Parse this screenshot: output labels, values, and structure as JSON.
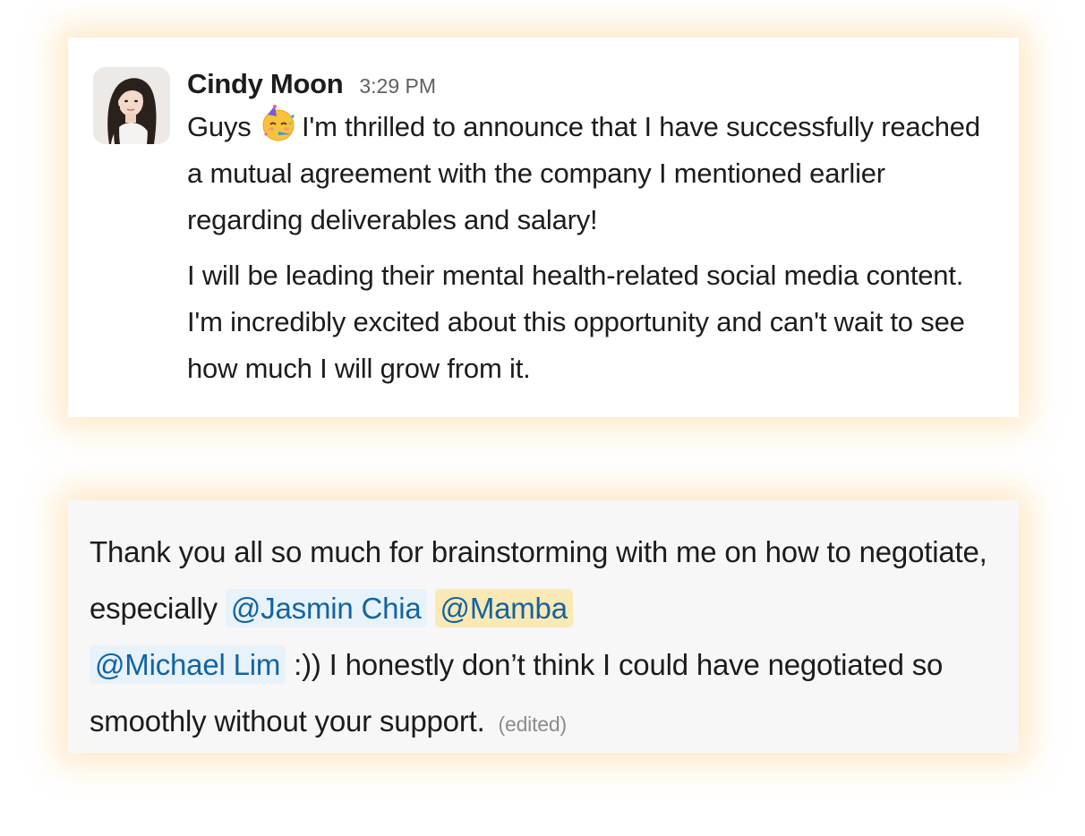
{
  "message_1": {
    "author": "Cindy Moon",
    "timestamp": "3:29 PM",
    "avatar": "woman-avatar-photo",
    "paragraph_1": {
      "lead": "Guys",
      "emoji": "partying-face-emoji",
      "text": "I'm thrilled to announce that I have successfully reached a mutual agreement with the company I mentioned earlier regarding deliverables and salary!"
    },
    "paragraph_2": "I will be leading their mental health-related social media content. I'm incredibly excited about this opportunity and can't wait to see how much I will grow from it."
  },
  "message_2": {
    "text_before": "Thank you all so much for brainstorming with me on how to negotiate, especially",
    "mentions": [
      "@Jasmin Chia",
      "@Mamba",
      "@Michael Lim"
    ],
    "text_after": ":)) I honestly don’t think I could have negotiated so smoothly without your support.",
    "edited_label": "(edited)"
  },
  "colors": {
    "mention_text": "#1264a3",
    "mention_bg": "#e8f2fa",
    "self_mention_bg": "#fbe9b5",
    "glow": "#ffc878"
  }
}
